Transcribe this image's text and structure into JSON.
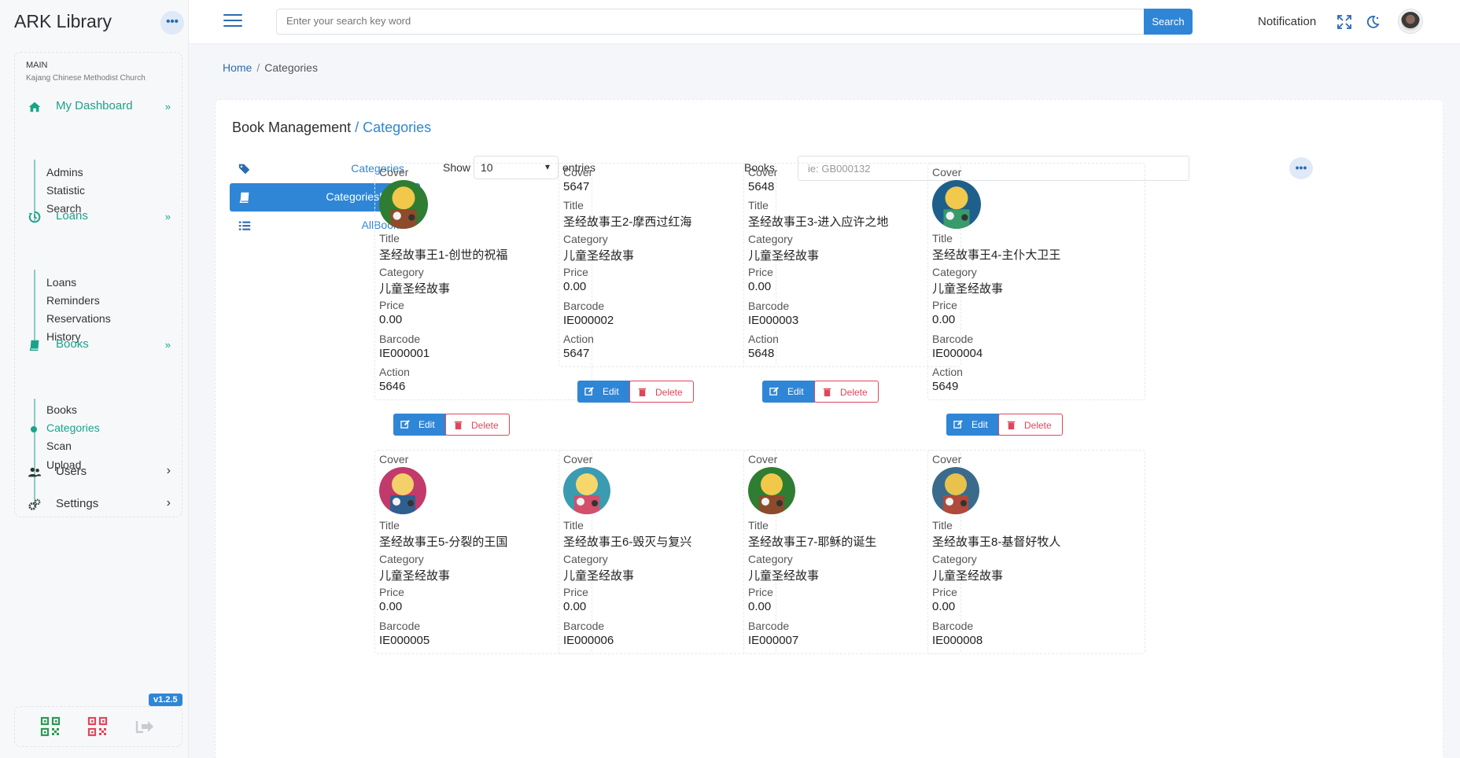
{
  "app": {
    "brand": "ARK Library",
    "version": "v1.2.5"
  },
  "sidebar": {
    "section": "MAIN",
    "org": "Kajang Chinese Methodist Church",
    "groups": [
      {
        "label": "My Dashboard",
        "icon": "home-icon",
        "items": [
          "Admins",
          "Statistic",
          "Search"
        ]
      },
      {
        "label": "Loans",
        "icon": "history-icon",
        "items": [
          "Loans",
          "Reminders",
          "Reservations",
          "History"
        ]
      },
      {
        "label": "Books",
        "icon": "book-icon",
        "items": [
          "Books",
          "Categories",
          "Scan",
          "Upload"
        ],
        "active_item": "Categories"
      }
    ],
    "plain": [
      {
        "label": "Users",
        "icon": "users-icon"
      },
      {
        "label": "Settings",
        "icon": "gear-icon"
      }
    ]
  },
  "topbar": {
    "search_placeholder": "Enter your search key word",
    "search_button": "Search",
    "notification": "Notification"
  },
  "breadcrumb": {
    "home": "Home",
    "current": "Categories"
  },
  "card": {
    "title": "Book Management",
    "subtitle": "/ Categories",
    "tabs": [
      "Categories",
      "CategoriesBook",
      "AllBooks"
    ],
    "active_tab": "CategoriesBook",
    "show_label": "Show",
    "entries_value": "10",
    "entries_label": "entries",
    "books_label": "Books",
    "books_placeholder": "ie: GB000132"
  },
  "labels": {
    "cover": "Cover",
    "title": "Title",
    "category": "Category",
    "price": "Price",
    "barcode": "Barcode",
    "action": "Action",
    "edit": "Edit",
    "delete": "Delete"
  },
  "books": [
    {
      "cover": "",
      "title": "圣经故事王1-创世的祝福",
      "category": "儿童圣经故事",
      "price": "0.00",
      "barcode": "IE000001",
      "action": "5646"
    },
    {
      "cover": "5647",
      "title": "圣经故事王2-摩西过红海",
      "category": "儿童圣经故事",
      "price": "0.00",
      "barcode": "IE000002",
      "action": "5647"
    },
    {
      "cover": "5648",
      "title": "圣经故事王3-进入应许之地",
      "category": "儿童圣经故事",
      "price": "0.00",
      "barcode": "IE000003",
      "action": "5648"
    },
    {
      "cover": "",
      "title": "圣经故事王4-主仆大卫王",
      "category": "儿童圣经故事",
      "price": "0.00",
      "barcode": "IE000004",
      "action": "5649"
    },
    {
      "cover": "",
      "title": "圣经故事王5-分裂的王国",
      "category": "儿童圣经故事",
      "price": "0.00",
      "barcode": "IE000005"
    },
    {
      "cover": "",
      "title": "圣经故事王6-毁灭与复兴",
      "category": "儿童圣经故事",
      "price": "0.00",
      "barcode": "IE000006"
    },
    {
      "cover": "",
      "title": "圣经故事王7-耶稣的诞生",
      "category": "儿童圣经故事",
      "price": "0.00",
      "barcode": "IE000007"
    },
    {
      "cover": "",
      "title": "圣经故事王8-基督好牧人",
      "category": "儿童圣经故事",
      "price": "0.00",
      "barcode": "IE000008"
    }
  ],
  "colors": {
    "accent": "#2f86d6",
    "green": "#1aa38a",
    "danger": "#e0465a"
  }
}
